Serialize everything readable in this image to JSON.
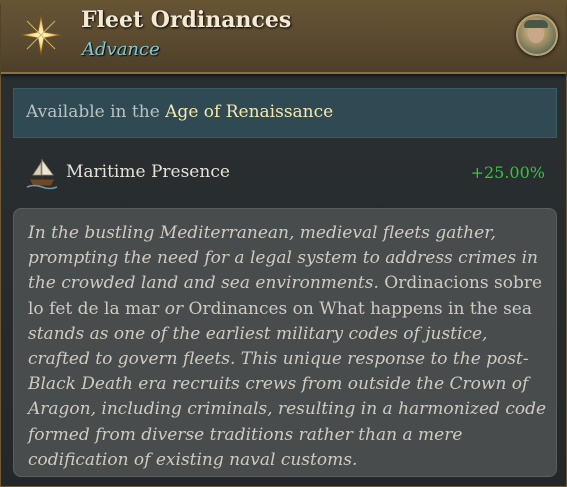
{
  "header": {
    "title": "Fleet Ordinances",
    "subtitle": "Advance",
    "icon": "compass-star-icon",
    "portrait": "advisor-portrait"
  },
  "availability": {
    "prefix": "Available in the ",
    "age": "Age of Renaissance"
  },
  "modifier": {
    "icon": "ship-icon",
    "label": "Maritime Presence",
    "value": "+25.00%"
  },
  "description": {
    "seg0": "In the bustling Mediterranean, medieval fleets gather, prompting the need for a legal system to address crimes in the crowded land and sea environments.",
    "seg1": " Ordinacions sobre lo fet de la mar ",
    "seg2": "or",
    "seg3": " Ordinances on What happens in the sea ",
    "seg4": "stands as one of the earliest military codes of justice, crafted to govern fleets. This unique response to the post-Black Death era recruits crews from outside the Crown of Aragon, including criminals, resulting in a harmonized code formed from diverse traditions rather than a mere codification of existing naval customs."
  },
  "colors": {
    "header_bg": "#5a4a30",
    "subtitle": "#7fc8d8",
    "age_highlight": "#f4e8b0",
    "positive_value": "#39c23c",
    "description_text": "#cfcbc2"
  }
}
